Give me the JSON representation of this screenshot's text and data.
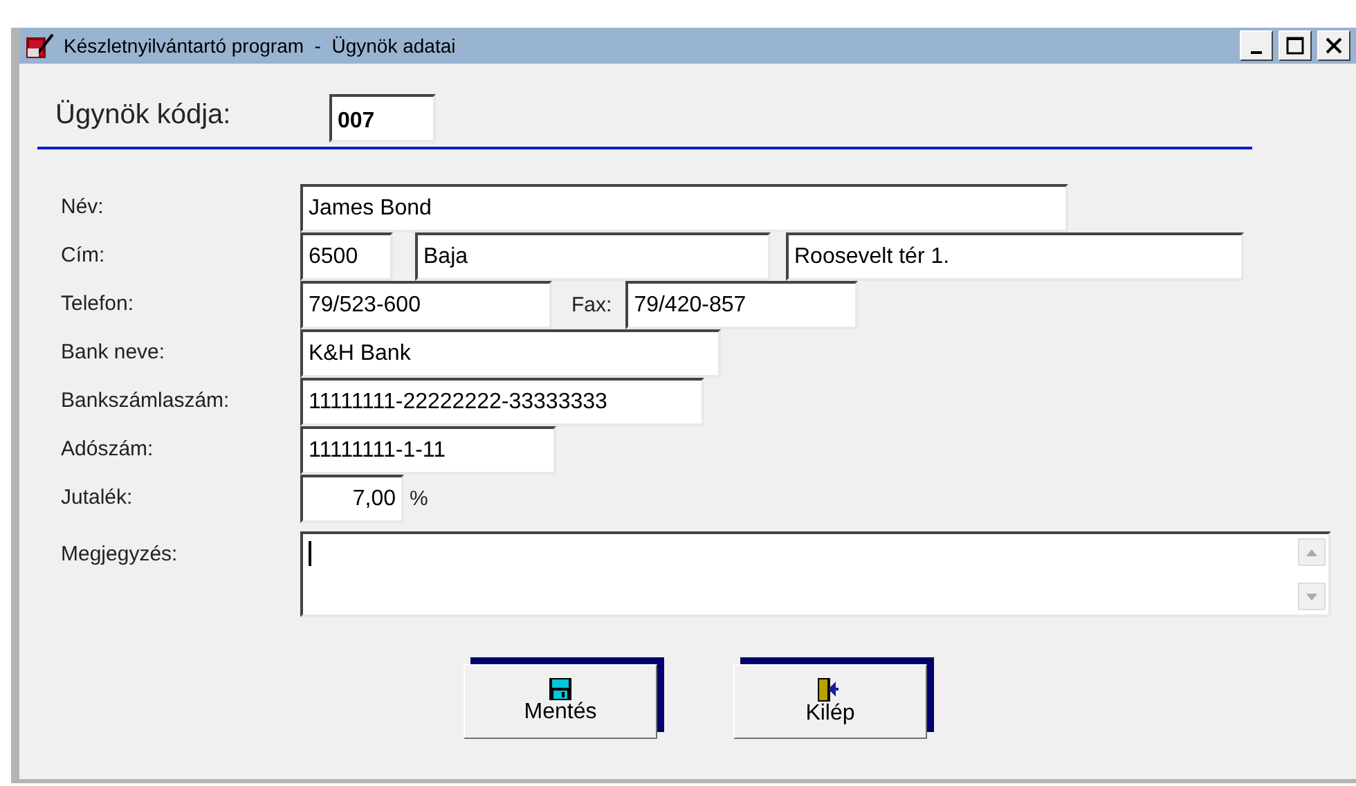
{
  "window": {
    "title": "Készletnyilvántartó program  -  Ügynök adatai"
  },
  "code": {
    "label": "Ügynök kódja:",
    "value": "007"
  },
  "rows": [
    {
      "label": "Név:",
      "items": [
        {
          "kind": "field",
          "value": "James Bond"
        }
      ]
    },
    {
      "label": "Cím:",
      "items": [
        {
          "kind": "field",
          "value": "6500"
        },
        {
          "kind": "field",
          "value": "Baja"
        },
        {
          "kind": "field",
          "value": "Roosevelt tér 1."
        }
      ]
    },
    {
      "label": "Telefon:",
      "items": [
        {
          "kind": "field",
          "value": "79/523-600"
        },
        {
          "kind": "text",
          "value": "Fax:"
        },
        {
          "kind": "field",
          "value": "79/420-857"
        }
      ]
    },
    {
      "label": "Bank neve:",
      "items": [
        {
          "kind": "field",
          "value": "K&H Bank"
        }
      ]
    },
    {
      "label": "Bankszámlaszám:",
      "items": [
        {
          "kind": "field",
          "value": "11111111-22222222-33333333"
        }
      ]
    },
    {
      "label": "Adószám:",
      "items": [
        {
          "kind": "field",
          "value": "11111111-1-11"
        }
      ]
    },
    {
      "label": "Jutalék:",
      "items": [
        {
          "kind": "number",
          "value": "7,00"
        },
        {
          "kind": "text",
          "value": "%"
        }
      ]
    },
    {
      "label": "Megjegyzés:",
      "items": [
        {
          "kind": "memo"
        }
      ]
    }
  ],
  "buttons": [
    {
      "kind": "save",
      "label": "Mentés"
    },
    {
      "kind": "exit",
      "label": "Kilép"
    }
  ]
}
